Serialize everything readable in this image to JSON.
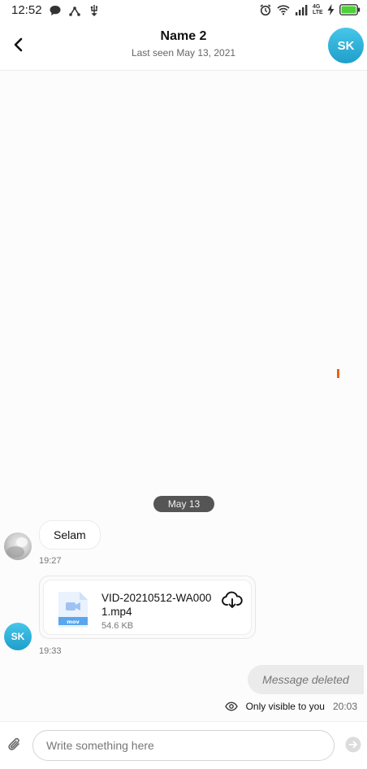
{
  "status_bar": {
    "time": "12:52",
    "network_label": "4G LTE",
    "left_icons": [
      "chat-bubble-icon",
      "network-share-icon",
      "usb-icon"
    ],
    "right_icons": [
      "alarm-icon",
      "wifi-icon",
      "signal-icon",
      "charging-icon",
      "battery-icon"
    ]
  },
  "header": {
    "title": "Name 2",
    "subtitle": "Last seen May 13, 2021",
    "avatar_initials": "SK",
    "back_icon": "chevron-left-icon"
  },
  "chat": {
    "date_divider": "May 13",
    "messages": [
      {
        "type": "text",
        "text": "Selam",
        "time": "19:27",
        "direction": "incoming"
      },
      {
        "type": "file",
        "file_name": "VID-20210512-WA0001.mp4",
        "file_size": "54.6 KB",
        "file_type": "mov",
        "time": "19:33",
        "sender_initials": "SK",
        "direction": "incoming"
      },
      {
        "type": "deleted",
        "text": "Message deleted",
        "visibility": "Only visible to you",
        "time": "20:03",
        "direction": "outgoing"
      }
    ]
  },
  "composer": {
    "placeholder": "Write something here",
    "value": "",
    "attach_icon": "paperclip-icon",
    "send_icon": "send-icon"
  },
  "colors": {
    "accent": "#2aa7d4",
    "date_pill": "#555555",
    "deleted_bubble": "#ebebeb",
    "orange_mark": "#e8621a"
  }
}
